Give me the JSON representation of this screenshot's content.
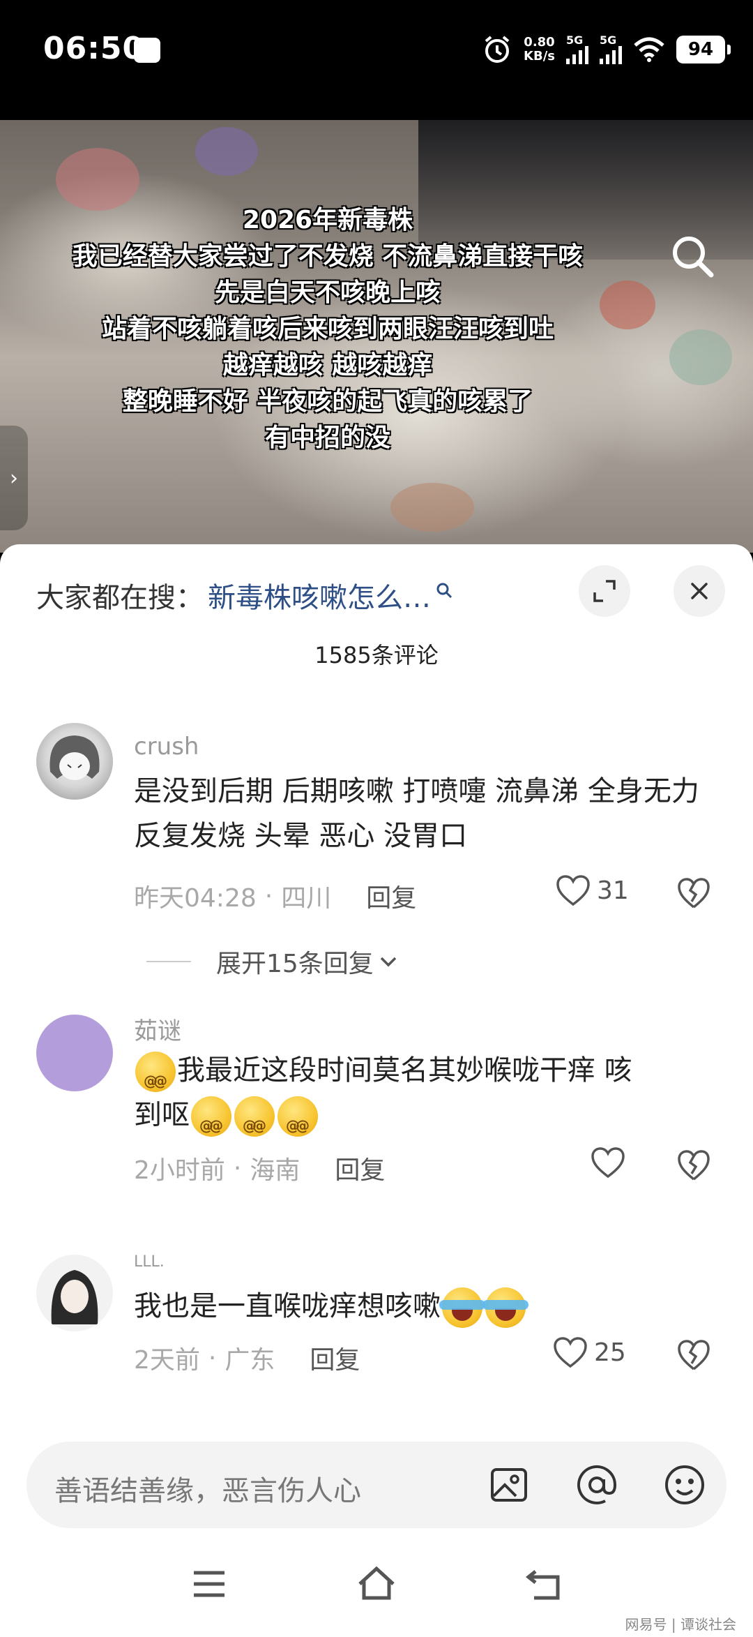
{
  "status_bar": {
    "time": "06:50",
    "net_speed_value": "0.80",
    "net_speed_unit": "KB/s",
    "signal1_label": "5G",
    "signal2_label": "5G",
    "battery": "94"
  },
  "video": {
    "caption_lines": [
      "2026年新毒株",
      "我已经替大家尝过了不发烧 不流鼻涕直接干咳",
      "先是白天不咳晚上咳",
      "站着不咳躺着咳后来咳到两眼汪汪咳到吐",
      "越痒越咳 越咳越痒",
      "整晚睡不好 半夜咳的起飞真的咳累了",
      "有中招的没"
    ],
    "prev_arrow": "›"
  },
  "sheet": {
    "search_prefix": "大家都在搜：",
    "search_link": "新毒株咳嗽怎么…",
    "comment_count": "1585条评论"
  },
  "comments": [
    {
      "user": "crush",
      "text": "是没到后期 后期咳嗽 打喷嚏 流鼻涕 全身无力 反复发烧 头晕 恶心 没胃口",
      "time": "昨天04:28",
      "sep": "·",
      "location": "四川",
      "reply": "回复",
      "likes": "31",
      "expand": "展开15条回复"
    },
    {
      "user": "茹谜",
      "text_main": "我最近这段时间莫名其妙喉咙干痒 咳到呕",
      "text_part1": "我最近这段时间莫名其妙喉咙干痒 咳",
      "text_part2": "到呕",
      "time": "2小时前",
      "sep": "·",
      "location": "海南",
      "reply": "回复",
      "avatar_color": "#b39ddb"
    },
    {
      "user": "LLL.",
      "text": "我也是一直喉咙痒想咳嗽",
      "time": "2天前",
      "sep": "·",
      "location": "广东",
      "reply": "回复",
      "likes": "25"
    }
  ],
  "input": {
    "placeholder": "善语结善缘，恶言伤人心"
  },
  "watermark": "网易号 | 谭谈社会",
  "icons": [
    "search-icon",
    "expand-icon",
    "close-icon",
    "heart-icon",
    "broken-heart-icon",
    "image-icon",
    "at-icon",
    "emoji-icon",
    "menu-icon",
    "home-icon",
    "back-icon"
  ]
}
